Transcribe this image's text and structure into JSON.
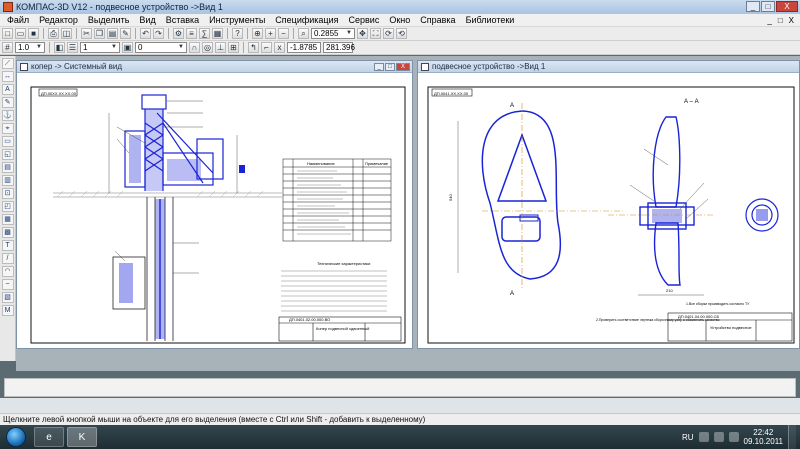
{
  "window": {
    "title": "КОМПАС-3D V12 - подвесное устройство ->Вид 1",
    "minimize": "_",
    "maximize": "□",
    "close": "X"
  },
  "menu": {
    "items": [
      "Файл",
      "Редактор",
      "Выделить",
      "Вид",
      "Вставка",
      "Инструменты",
      "Спецификация",
      "Сервис",
      "Окно",
      "Справка",
      "Библиотеки"
    ]
  },
  "toolbar": {
    "zoom_value": "0.2855",
    "scale_value": "1.0",
    "layer_value": "1",
    "style_value": "0",
    "coord_x": "-1.8785",
    "coord_y": "281.396"
  },
  "windows": {
    "left_title": "копер -> Системный вид",
    "right_title": "подвесное устройство ->Вид 1"
  },
  "drawing_left": {
    "stamp_code": "ДП.00ХХ.ХХ.ХХ.00",
    "spec_col_name": "Наименование",
    "spec_col_qty": "Примечание",
    "tech_heading": "Технические характеристики",
    "title_block_name": "Копер подвесной сдвоенный",
    "title_block_code": "ДП.0401.02.00.000.ВО"
  },
  "drawing_right": {
    "stamp_code": "ДП.0041.ХХ.ХХ.00",
    "section_label": "А – А",
    "cut_label_top": "А",
    "cut_label_bottom": "А",
    "note_text": "2.Проверить соответствие чертежа сборочному узлу и обеспечить качество",
    "note_right": "1.Все сборки производить согласно ТУ",
    "title_block_name": "Устройство подвесное",
    "title_block_code": "ДП.0401.04.00.000.СБ",
    "dim_left": "540",
    "dim_bottom": "210"
  },
  "status": {
    "hint": "Щелкните левой кнопкой мыши на объекте для его выделения (вместе с Ctrl или Shift - добавить к выделенному)"
  },
  "taskbar": {
    "lang": "RU",
    "time": "22:42",
    "date": "09.10.2011"
  }
}
